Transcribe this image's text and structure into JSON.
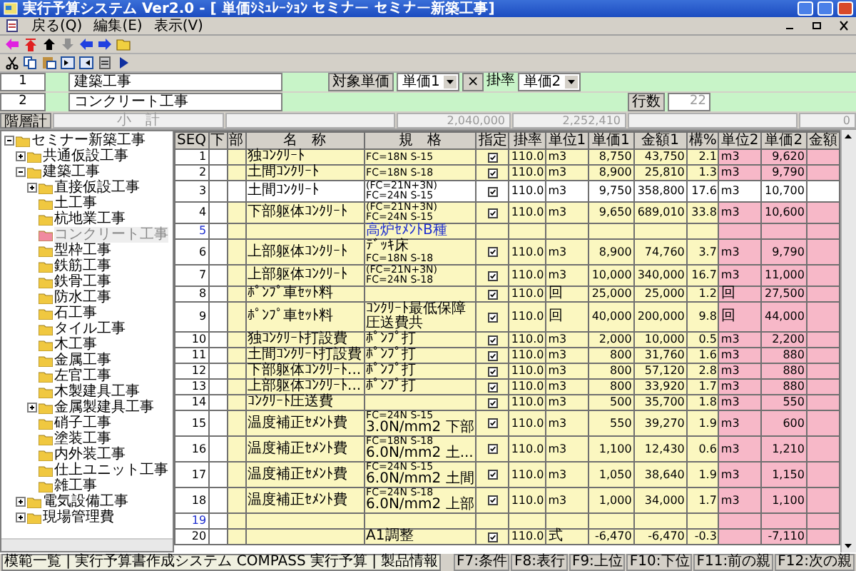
{
  "window": {
    "title": "実行予算システム Ver2.0 - [ 単価ｼﾐｭﾚｰｼｮﾝ セミナー セミナー新築工事]"
  },
  "menu": [
    "戻る(Q)",
    "編集(E)",
    "表示(V)"
  ],
  "form": {
    "level1": {
      "no": "1",
      "value": "建築工事"
    },
    "level2": {
      "no": "2",
      "value": "コンクリート工事"
    },
    "target_label": "対象単価",
    "target_select": "単価1",
    "times": "×",
    "rate_label": "掛率",
    "rate_select": "単価2",
    "rows_label": "行数",
    "rows_value": "22"
  },
  "summary": {
    "label": "階層計",
    "subtotal_label": "小　計",
    "amount1": "2,040,000",
    "amount2": "2,252,410",
    "count": "0"
  },
  "tree": {
    "label": "セミナー新築工事",
    "expanded": true,
    "selected": false,
    "children": [
      {
        "label": "共通仮設工事",
        "expanded": false,
        "selected": false
      },
      {
        "label": "建築工事",
        "expanded": true,
        "selected": false,
        "children": [
          {
            "label": "直接仮設工事",
            "expanded": false,
            "selected": false
          },
          {
            "label": "土工事",
            "selected": false
          },
          {
            "label": "杭地業工事",
            "selected": false
          },
          {
            "label": "コンクリート工事",
            "selected": true
          },
          {
            "label": "型枠工事",
            "selected": false
          },
          {
            "label": "鉄筋工事",
            "selected": false
          },
          {
            "label": "鉄骨工事",
            "selected": false
          },
          {
            "label": "防水工事",
            "selected": false
          },
          {
            "label": "石工事",
            "selected": false
          },
          {
            "label": "タイル工事",
            "selected": false
          },
          {
            "label": "木工事",
            "selected": false
          },
          {
            "label": "金属工事",
            "selected": false
          },
          {
            "label": "左官工事",
            "selected": false
          },
          {
            "label": "木製建具工事",
            "selected": false
          },
          {
            "label": "金属製建具工事",
            "expanded": false,
            "selected": false
          },
          {
            "label": "硝子工事",
            "selected": false
          },
          {
            "label": "塗装工事",
            "selected": false
          },
          {
            "label": "内外装工事",
            "selected": false
          },
          {
            "label": "仕上ユニット工事",
            "selected": false
          },
          {
            "label": "雑工事",
            "selected": false
          }
        ]
      },
      {
        "label": "電気設備工事",
        "expanded": false,
        "selected": false
      },
      {
        "label": "現場管理費",
        "expanded": false,
        "selected": false
      }
    ]
  },
  "grid": {
    "columns": [
      "SEQ",
      "下",
      "部",
      "名　称",
      "規　格",
      "指定",
      "掛率",
      "単位1",
      "単価1",
      "金額1",
      "構%",
      "単位2",
      "単価2",
      "金額"
    ],
    "rows": [
      {
        "kind": "item",
        "seq": "1",
        "name": "独ｺﾝｸﾘｰﾄ",
        "spec": [
          "FC=18N S-15"
        ],
        "checked": true,
        "rate": "110.0",
        "unit1": "m3",
        "price1": "8,750",
        "amount1": "43,750",
        "ratio": "2.1",
        "unit2": "m3",
        "price2": "9,620",
        "selected": false
      },
      {
        "kind": "item",
        "seq": "2",
        "name": "土間ｺﾝｸﾘｰﾄ",
        "spec": [
          "FC=18N S-18"
        ],
        "checked": true,
        "rate": "110.0",
        "unit1": "m3",
        "price1": "8,900",
        "amount1": "25,810",
        "ratio": "1.3",
        "unit2": "m3",
        "price2": "9,790",
        "selected": false
      },
      {
        "kind": "item",
        "seq": "3",
        "name": "土間ｺﾝｸﾘｰﾄ",
        "spec": [
          "(FC=21N+3N)",
          "FC=24N S-15"
        ],
        "checked": true,
        "rate": "110.0",
        "unit1": "m3",
        "price1": "9,750",
        "amount1": "358,800",
        "ratio": "17.6",
        "unit2": "m3",
        "price2": "10,700",
        "selected": true
      },
      {
        "kind": "item",
        "seq": "4",
        "name": "下部躯体ｺﾝｸﾘｰﾄ",
        "spec": [
          "(FC=21N+3N)",
          "FC=24N S-15"
        ],
        "checked": true,
        "rate": "110.0",
        "unit1": "m3",
        "price1": "9,650",
        "amount1": "689,010",
        "ratio": "33.8",
        "unit2": "m3",
        "price2": "10,600",
        "selected": false
      },
      {
        "kind": "note",
        "seq": "5",
        "spec": [
          "高炉ｾﾒﾝﾄB種"
        ],
        "selected": false
      },
      {
        "kind": "item",
        "seq": "6",
        "name": "上部躯体ｺﾝｸﾘｰﾄ",
        "spec": [
          "ﾃﾞｯｷ床",
          "FC=18N S-18"
        ],
        "checked": true,
        "rate": "110.0",
        "unit1": "m3",
        "price1": "8,900",
        "amount1": "74,760",
        "ratio": "3.7",
        "unit2": "m3",
        "price2": "9,790",
        "selected": false
      },
      {
        "kind": "item",
        "seq": "7",
        "name": "上部躯体ｺﾝｸﾘｰﾄ",
        "spec": [
          "(FC=21N+3N)",
          "FC=24N S-18"
        ],
        "checked": true,
        "rate": "110.0",
        "unit1": "m3",
        "price1": "10,000",
        "amount1": "340,000",
        "ratio": "16.7",
        "unit2": "m3",
        "price2": "11,000",
        "selected": false
      },
      {
        "kind": "item",
        "seq": "8",
        "name": "ﾎﾟﾝﾌﾟ車ｾｯﾄ料",
        "checked": true,
        "rate": "110.0",
        "unit1": "回",
        "price1": "25,000",
        "amount1": "25,000",
        "ratio": "1.2",
        "unit2": "回",
        "price2": "27,500",
        "selected": false
      },
      {
        "kind": "item",
        "seq": "9",
        "name": "ﾎﾟﾝﾌﾟ車ｾｯﾄ料",
        "spec": [
          "ｺﾝｸﾘｰﾄ最低保障",
          "圧送費共"
        ],
        "checked": true,
        "rate": "110.0",
        "unit1": "回",
        "price1": "40,000",
        "amount1": "200,000",
        "ratio": "9.8",
        "unit2": "回",
        "price2": "44,000",
        "selected": false
      },
      {
        "kind": "item",
        "seq": "10",
        "name": "独ｺﾝｸﾘｰﾄ打設費",
        "spec": [
          "ﾎﾟﾝﾌﾟ打"
        ],
        "checked": true,
        "rate": "110.0",
        "unit1": "m3",
        "price1": "2,000",
        "amount1": "10,000",
        "ratio": "0.5",
        "unit2": "m3",
        "price2": "2,200",
        "selected": false
      },
      {
        "kind": "item",
        "seq": "11",
        "name": "土間ｺﾝｸﾘｰﾄ打設費",
        "spec": [
          "ﾎﾟﾝﾌﾟ打"
        ],
        "checked": true,
        "rate": "110.0",
        "unit1": "m3",
        "price1": "800",
        "amount1": "31,760",
        "ratio": "1.6",
        "unit2": "m3",
        "price2": "880",
        "selected": false
      },
      {
        "kind": "item",
        "seq": "12",
        "name": "下部躯体ｺﾝｸﾘｰﾄ...",
        "spec": [
          "ﾎﾟﾝﾌﾟ打"
        ],
        "checked": true,
        "rate": "110.0",
        "unit1": "m3",
        "price1": "800",
        "amount1": "57,120",
        "ratio": "2.8",
        "unit2": "m3",
        "price2": "880",
        "selected": false
      },
      {
        "kind": "item",
        "seq": "13",
        "name": "上部躯体ｺﾝｸﾘｰﾄ...",
        "spec": [
          "ﾎﾟﾝﾌﾟ打"
        ],
        "checked": true,
        "rate": "110.0",
        "unit1": "m3",
        "price1": "800",
        "amount1": "33,920",
        "ratio": "1.7",
        "unit2": "m3",
        "price2": "880",
        "selected": false
      },
      {
        "kind": "item",
        "seq": "14",
        "name": "ｺﾝｸﾘｰﾄ圧送費",
        "checked": true,
        "rate": "110.0",
        "unit1": "m3",
        "price1": "500",
        "amount1": "35,700",
        "ratio": "1.8",
        "unit2": "m3",
        "price2": "550",
        "selected": false
      },
      {
        "kind": "item",
        "seq": "15",
        "name": "温度補正ｾﾒﾝﾄ費",
        "spec": [
          "FC=24N S-15",
          "3.0N/mm2 下部"
        ],
        "checked": true,
        "rate": "110.0",
        "unit1": "m3",
        "price1": "550",
        "amount1": "39,270",
        "ratio": "1.9",
        "unit2": "m3",
        "price2": "600",
        "selected": false
      },
      {
        "kind": "item",
        "seq": "16",
        "name": "温度補正ｾﾒﾝﾄ費",
        "spec": [
          "FC=18N S-18",
          "6.0N/mm2 土..."
        ],
        "checked": true,
        "rate": "110.0",
        "unit1": "m3",
        "price1": "1,100",
        "amount1": "12,430",
        "ratio": "0.6",
        "unit2": "m3",
        "price2": "1,210",
        "selected": false
      },
      {
        "kind": "item",
        "seq": "17",
        "name": "温度補正ｾﾒﾝﾄ費",
        "spec": [
          "FC=24N S-15",
          "6.0N/mm2 土間"
        ],
        "checked": true,
        "rate": "110.0",
        "unit1": "m3",
        "price1": "1,050",
        "amount1": "38,640",
        "ratio": "1.9",
        "unit2": "m3",
        "price2": "1,150",
        "selected": false
      },
      {
        "kind": "item",
        "seq": "18",
        "name": "温度補正ｾﾒﾝﾄ費",
        "spec": [
          "FC=24N S-18",
          "6.0N/mm2 上部"
        ],
        "checked": true,
        "rate": "110.0",
        "unit1": "m3",
        "price1": "1,000",
        "amount1": "34,000",
        "ratio": "1.7",
        "unit2": "m3",
        "price2": "1,100",
        "selected": false
      },
      {
        "kind": "blank",
        "seq": "19",
        "selected": false
      },
      {
        "kind": "item",
        "seq": "20",
        "spec": [
          "A1調整"
        ],
        "checked": true,
        "rate": "110.0",
        "unit1": "式",
        "price1": "-6,470",
        "amount1": "-6,470",
        "ratio": "-0.3",
        "price2": "-7,110",
        "selected": false
      }
    ]
  },
  "taskbar_popup": "模範一覧 | 実行予算書作成システム COMPASS 実行予算 | 製品情報",
  "status_bar": {
    "keys": [
      "F7:条件",
      "F8:表行",
      "F9:上位",
      "F10:下位",
      "F11:前の親",
      "F12:次の親"
    ]
  }
}
